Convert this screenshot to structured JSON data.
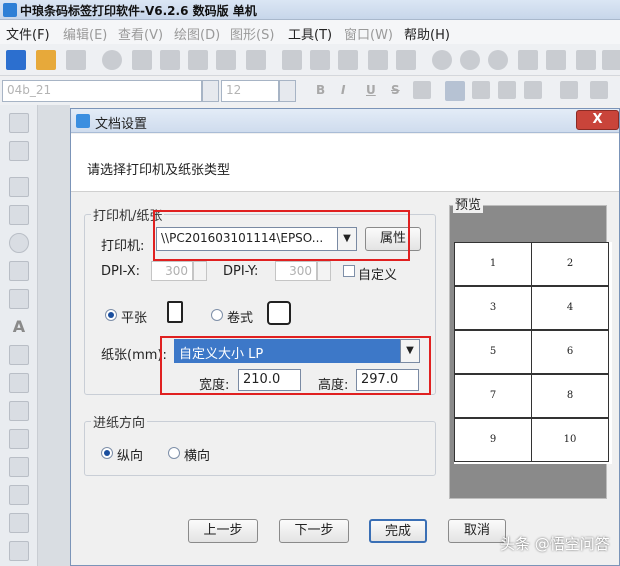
{
  "app": {
    "title": "中琅条码标签打印软件-V6.2.6 数码版 单机"
  },
  "menu": [
    {
      "label": "文件(F)",
      "enabled": true
    },
    {
      "label": "编辑(E)",
      "enabled": false
    },
    {
      "label": "查看(V)",
      "enabled": false
    },
    {
      "label": "绘图(D)",
      "enabled": false
    },
    {
      "label": "图形(S)",
      "enabled": false
    },
    {
      "label": "工具(T)",
      "enabled": true
    },
    {
      "label": "窗口(W)",
      "enabled": false
    },
    {
      "label": "帮助(H)",
      "enabled": true
    }
  ],
  "format_bar": {
    "font_name": "04b_21",
    "font_size": "12",
    "bold": "B",
    "italic": "I",
    "underline": "U",
    "strike": "S"
  },
  "dialog": {
    "title": "文档设置",
    "close": "X",
    "header": "请选择打印机及纸张类型",
    "printer_group": {
      "legend": "打印机/纸张",
      "printer_label": "打印机:",
      "printer_value": "\\\\PC201603101114\\EPSO...",
      "properties_button": "属性",
      "dpix_label": "DPI-X:",
      "dpix_value": "300",
      "dpiy_label": "DPI-Y:",
      "dpiy_value": "300",
      "custom_label": "自定义",
      "flat_label": "平张",
      "roll_label": "卷式",
      "paper_label": "纸张(mm):",
      "paper_value": "自定义大小 LP",
      "width_label": "宽度:",
      "width_value": "210.0",
      "height_label": "高度:",
      "height_value": "297.0"
    },
    "feed_group": {
      "legend": "进纸方向",
      "portrait": "纵向",
      "landscape": "横向"
    },
    "preview": {
      "label": "预览",
      "cells": [
        "1",
        "2",
        "3",
        "4",
        "5",
        "6",
        "7",
        "8",
        "9",
        "10"
      ]
    },
    "buttons": {
      "prev": "上一步",
      "next": "下一步",
      "finish": "完成",
      "cancel": "取消"
    }
  },
  "watermark": "头条 @悟空问答",
  "colors": {
    "highlight_red": "#e02020",
    "selected_combo": "#3d78c8",
    "title_blue": "#dbe6f4"
  }
}
